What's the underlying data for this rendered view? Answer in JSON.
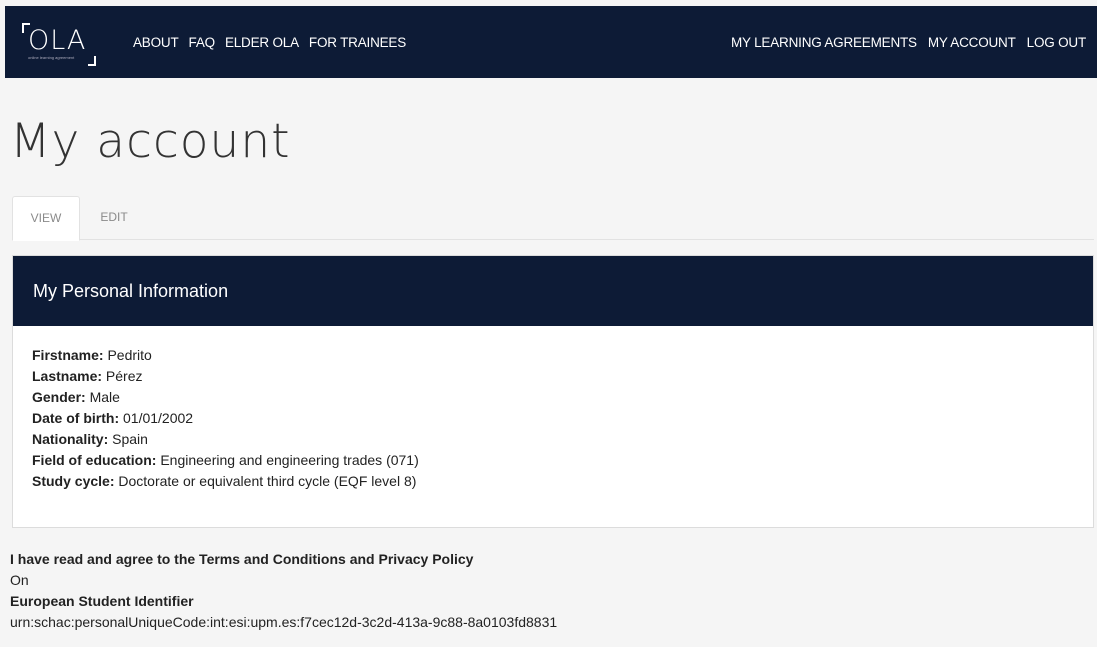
{
  "nav": {
    "logo_text": "OLA",
    "logo_tagline": "online learning agreement",
    "left_links": [
      "ABOUT",
      "FAQ",
      "ELDER OLA",
      "FOR TRAINEES"
    ],
    "right_links": [
      "MY LEARNING AGREEMENTS",
      "MY ACCOUNT",
      "LOG OUT"
    ]
  },
  "page": {
    "title": "My account"
  },
  "tabs": {
    "view": "VIEW",
    "edit": "EDIT"
  },
  "panel": {
    "title": "My Personal Information",
    "rows": [
      {
        "label": "Firstname:",
        "value": "Pedrito"
      },
      {
        "label": "Lastname:",
        "value": "Pérez"
      },
      {
        "label": "Gender:",
        "value": "Male"
      },
      {
        "label": "Date of birth:",
        "value": "01/01/2002"
      },
      {
        "label": "Nationality:",
        "value": "Spain"
      },
      {
        "label": "Field of education:",
        "value": "Engineering and engineering trades (071)"
      },
      {
        "label": "Study cycle:",
        "value": "Doctorate or equivalent third cycle (EQF level 8)"
      }
    ]
  },
  "terms": {
    "label": "I have read and agree to the Terms and Conditions and Privacy Policy",
    "value": "On"
  },
  "esi": {
    "label": "European Student Identifier",
    "value": "urn:schac:personalUniqueCode:int:esi:upm.es:f7cec12d-3c2d-413a-9c88-8a0103fd8831"
  }
}
